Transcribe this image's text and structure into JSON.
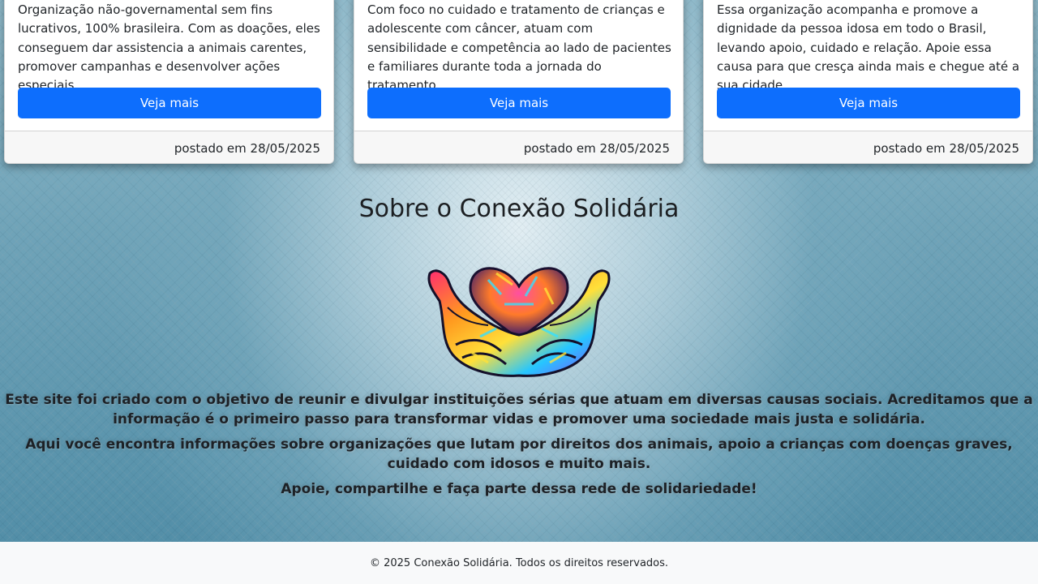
{
  "cards": [
    {
      "description": "Organização não-governamental sem fins lucrativos, 100% brasileira. Com as doações, eles conseguem dar assistencia a animais carentes, promover campanhas e desenvolver ações especiais.",
      "button_label": "Veja mais",
      "footer": "postado em 28/05/2025"
    },
    {
      "description": "Com foco no cuidado e tratamento de crianças e adolescente com câncer, atuam com sensibilidade e competência ao lado de pacientes e familiares durante toda a jornada do tratamento.",
      "button_label": "Veja mais",
      "footer": "postado em 28/05/2025"
    },
    {
      "description": "Essa organização acompanha e promove a dignidade da pessoa idosa em todo o Brasil, levando apoio, cuidado e relação. Apoie essa causa para que cresça ainda mais e chegue até a sua cidade.",
      "button_label": "Veja mais",
      "footer": "postado em 28/05/2025"
    }
  ],
  "about": {
    "title": "Sobre o Conexão Solidária",
    "image_icon": "colorful-hands-heart-icon",
    "paragraphs": [
      "Este site foi criado com o objetivo de reunir e divulgar instituições sérias que atuam em diversas causas sociais. Acreditamos que a informação é o primeiro passo para transformar vidas e promover uma sociedade mais justa e solidária.",
      "Aqui você encontra informações sobre organizações que lutam por direitos dos animais, apoio a crianças com doenças graves, cuidado com idosos e muito mais.",
      "Apoie, compartilhe e faça parte dessa rede de solidariedade!"
    ]
  },
  "footer": {
    "copyright": "© 2025 Conexão Solidária. Todos os direitos reservados."
  },
  "colors": {
    "button": "#0d6efd",
    "card_footer_bg": "#f7f7f7",
    "site_footer_bg": "#f8f9fa",
    "background_center": "#e8f2f6",
    "background_edge": "#4f8ca6"
  }
}
